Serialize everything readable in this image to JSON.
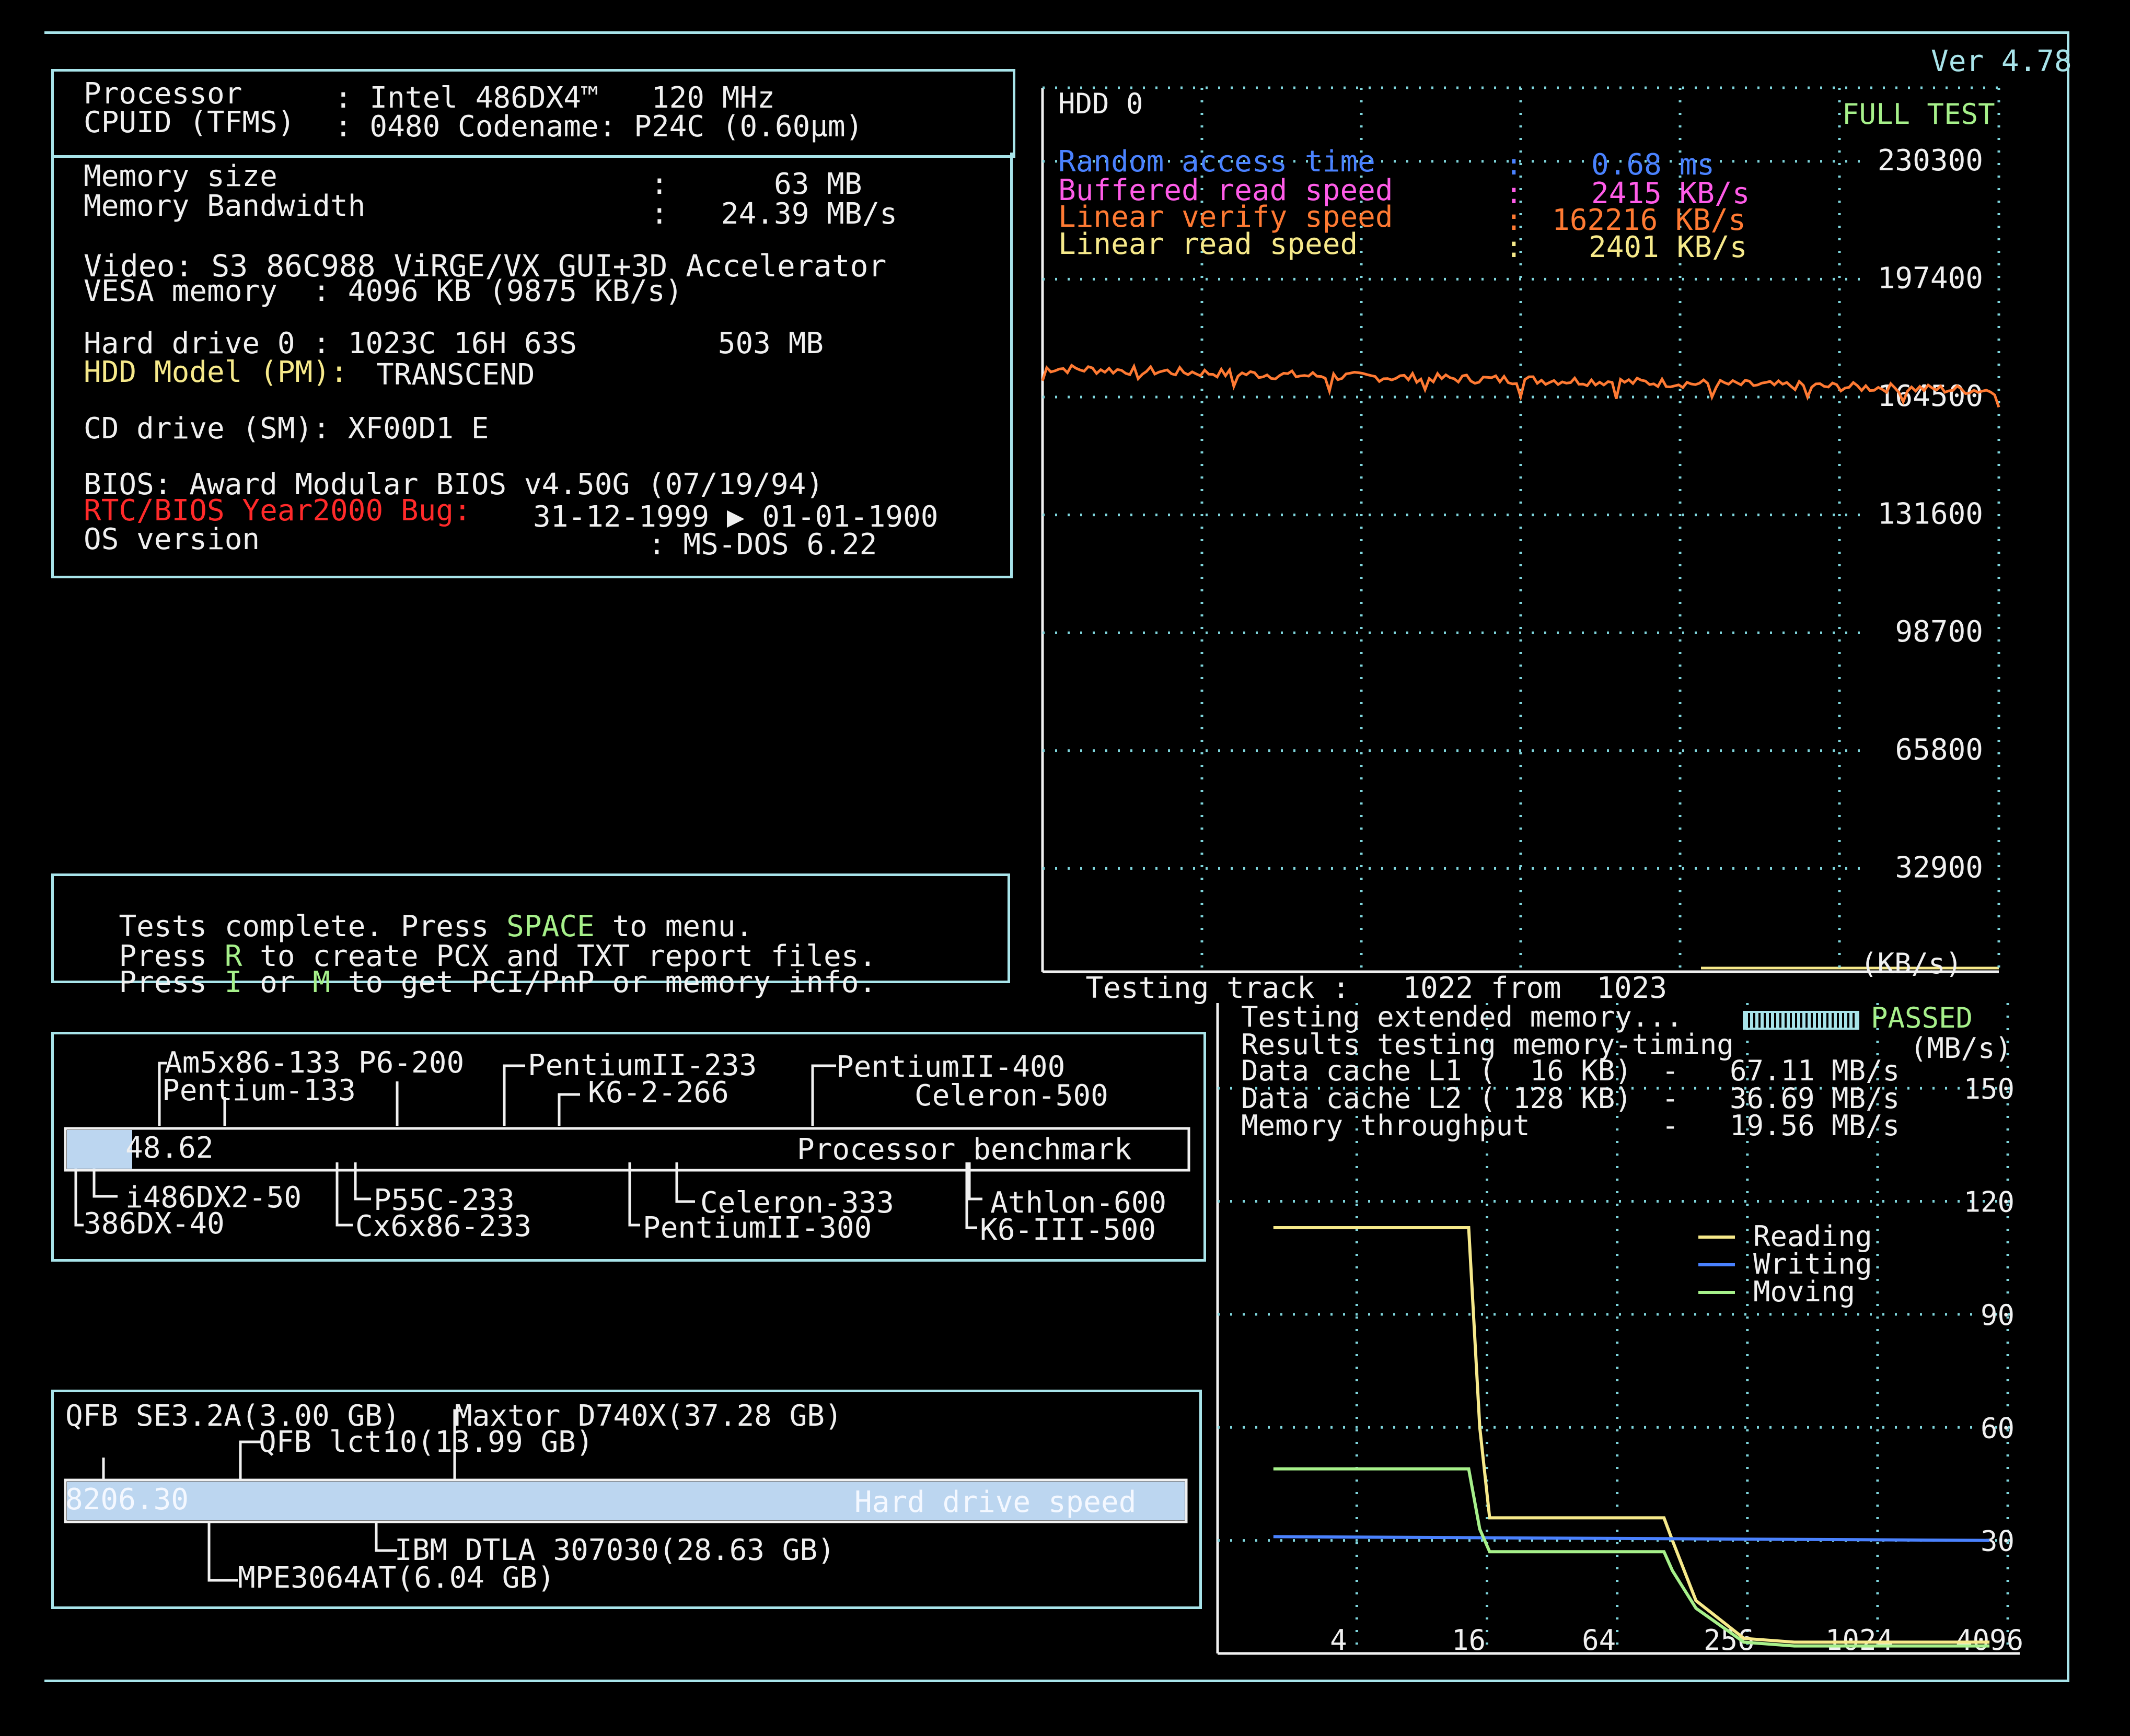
{
  "version": "Ver 4.78",
  "sysinfo": {
    "processor_label": "Processor",
    "processor_value": ": Intel 486DX4™   120 MHz",
    "cpuid_label": "CPUID (TFMS)",
    "cpuid_value": ": 0480 Codename: P24C (0.60µm)",
    "mem_size_label": "Memory size",
    "mem_size_value": ":      63 MB",
    "mem_bw_label": "Memory Bandwidth",
    "mem_bw_value": ":   24.39 MB/s",
    "video_line": "Video: S3 86C988 ViRGE/VX GUI+3D Accelerator",
    "vesa_line": "VESA memory  : 4096 KB (9875 KB/s)",
    "hdd0_line": "Hard drive 0 : 1023C 16H 63S        503 MB",
    "hdd_model_label": "HDD Model (PM):",
    "hdd_model_value": "TRANSCEND",
    "cd_line": "CD drive (SM): XF00D1 E",
    "bios_line": "BIOS: Award Modular BIOS v4.50G (07/19/94)",
    "rtc_label": "RTC/BIOS Year2000 Bug:",
    "rtc_value": "31-12-1999 ▶ 01-01-1900",
    "os_label": "OS version",
    "os_value": ": MS-DOS 6.22"
  },
  "messages": {
    "line1_pre": "Tests complete. Press ",
    "line1_key": "SPACE",
    "line1_post": " to menu.",
    "line2_pre": "Press ",
    "line2_key": "R",
    "line2_post": " to create PCX and TXT report files.",
    "line3_pre": "Press ",
    "line3_key1": "I",
    "line3_mid": " or ",
    "line3_key2": "M",
    "line3_post": " to get PCI/PnP or memory info."
  },
  "cpu_bench": {
    "value": "48.62",
    "title": "Processor benchmark",
    "top_labels": [
      "Am5x86-133 P6-200",
      "Pentium-133",
      "PentiumII-233",
      "K6-2-266",
      "PentiumII-400",
      "Celeron-500"
    ],
    "bottom_labels": [
      "i486DX2-50",
      "386DX-40",
      "P55C-233",
      "Cx6x86-233",
      "Celeron-333",
      "PentiumII-300",
      "Athlon-600",
      "K6-III-500"
    ]
  },
  "hdd_bench": {
    "value": "8206.30",
    "title": "Hard drive speed",
    "top_labels": [
      "QFB SE3.2A(3.00 GB)",
      "Maxtor D740X(37.28 GB)",
      "QFB lct10(13.99 GB)"
    ],
    "bottom_labels": [
      "IBM DTLA 307030(28.63 GB)",
      "MPE3064AT(6.04 GB)"
    ]
  },
  "hdd_chart": {
    "drive_label": "HDD 0",
    "mode": "FULL TEST",
    "stats": [
      {
        "label": "Random access time",
        "value": "0.68 ms",
        "color": "#4a82ff"
      },
      {
        "label": "Buffered read speed",
        "value": "2415 KB/s",
        "color": "#ff5ce8"
      },
      {
        "label": "Linear verify speed",
        "value": "162216 KB/s",
        "color": "#ff7a33"
      },
      {
        "label": "Linear read speed",
        "value": "2401 KB/s",
        "color": "#f6e98a"
      }
    ],
    "stat_sep": ":",
    "track_prefix": "Testing track : ",
    "track_current": "1022",
    "track_from": "from",
    "track_total": "1023",
    "unit": "(KB/s)"
  },
  "mem_chart": {
    "status_line": "Testing extended memory...",
    "passed": "PASSED",
    "results_title": "Results testing memory-timing",
    "unit": "(MB/s)",
    "rows": [
      {
        "label": "Data cache L1 (  16 KB)",
        "value": "-   67.11 MB/s"
      },
      {
        "label": "Data cache L2 ( 128 KB)",
        "value": "-   36.69 MB/s"
      },
      {
        "label": "Memory throughput",
        "value": "-   19.56 MB/s"
      }
    ],
    "legend": [
      {
        "name": "Reading",
        "color": "#f6e98a"
      },
      {
        "name": "Writing",
        "color": "#4a82ff"
      },
      {
        "name": "Moving",
        "color": "#a6f08a"
      }
    ]
  },
  "chart_data": [
    {
      "type": "line",
      "title": "HDD 0",
      "ylabel": "(KB/s)",
      "ylim": [
        0,
        246750
      ],
      "y_ticks": [
        32900,
        65800,
        98700,
        131600,
        164500,
        197400,
        230300
      ],
      "x_range": [
        0,
        1023
      ],
      "series": [
        {
          "name": "Linear verify speed",
          "color": "#ff7a33",
          "x": [
            0,
            100,
            200,
            300,
            400,
            500,
            600,
            700,
            800,
            900,
            1022
          ],
          "values": [
            168500,
            167800,
            167000,
            166300,
            165800,
            165300,
            164800,
            164200,
            163600,
            163000,
            162216
          ]
        }
      ],
      "grid": true
    },
    {
      "type": "line",
      "ylabel": "(MB/s)",
      "ylim": [
        0,
        165
      ],
      "y_ticks": [
        30,
        60,
        90,
        120,
        150
      ],
      "x_ticks": [
        4,
        16,
        64,
        256,
        1024,
        4096
      ],
      "x_scale": "log",
      "x_label_unit": "KB",
      "series": [
        {
          "name": "Reading",
          "color": "#f6e98a",
          "x": [
            2,
            16,
            18,
            20,
            128,
            140,
            180,
            300,
            512,
            1024,
            4096
          ],
          "values": [
            113,
            113,
            60,
            36,
            36,
            30,
            14,
            4,
            3,
            3,
            3
          ]
        },
        {
          "name": "Writing",
          "color": "#4a82ff",
          "x": [
            2,
            4096
          ],
          "values": [
            31,
            30
          ]
        },
        {
          "name": "Moving",
          "color": "#a6f08a",
          "x": [
            2,
            16,
            18,
            20,
            128,
            140,
            180,
            300,
            512,
            1024,
            4096
          ],
          "values": [
            49,
            49,
            33,
            27,
            27,
            22,
            12,
            3,
            2,
            2,
            2
          ]
        }
      ],
      "legend_position": "right",
      "grid": true
    }
  ]
}
